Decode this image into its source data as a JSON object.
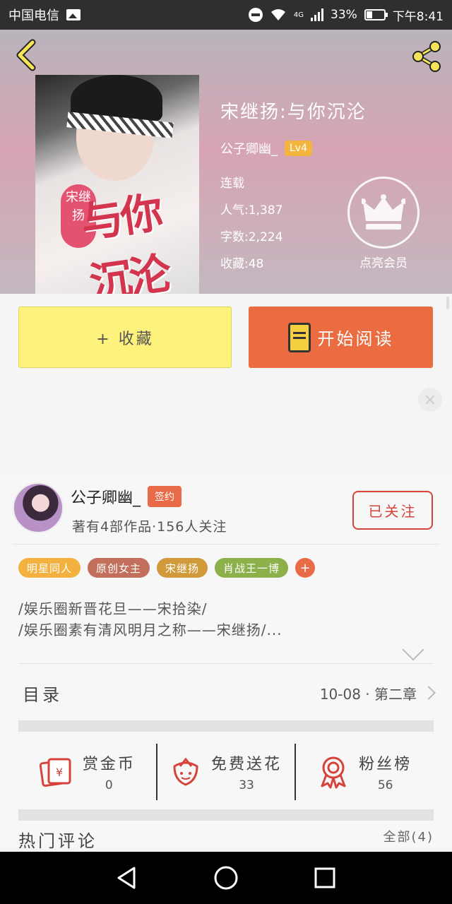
{
  "status_bar": {
    "carrier": "中国电信",
    "battery": "33%",
    "time": "下午8:41",
    "network": "4G"
  },
  "book": {
    "title": "宋继扬:与你沉沦",
    "author": "公子卿幽_",
    "level": "Lv4",
    "status": "连载",
    "popularity": "人气:1,387",
    "word_count": "字数:2,224",
    "favorites": "收藏:48",
    "cover_title": "与你沉沦",
    "cover_seal": "宋继扬"
  },
  "vip": {
    "label": "点亮会员"
  },
  "actions": {
    "favorite_label": "+ 收藏",
    "read_label": "开始阅读"
  },
  "ad": {
    "close": "×"
  },
  "author_card": {
    "name": "公子卿幽_",
    "badge": "签约",
    "summary": "著有4部作品·156人关注",
    "follow_label": "已关注"
  },
  "tags": [
    {
      "label": "明星同人",
      "color": "#f3b23f"
    },
    {
      "label": "原创女主",
      "color": "#c26f5b"
    },
    {
      "label": "宋继扬",
      "color": "#d19a3a"
    },
    {
      "label": "肖战王一博",
      "color": "#8cb04a"
    }
  ],
  "tag_add": "+",
  "description": {
    "line1": "/娱乐圈新晋花旦——宋拾染/",
    "line2": "/娱乐圈素有清风明月之称——宋继扬/..."
  },
  "toc": {
    "title": "目录",
    "latest": "10-08 · 第二章"
  },
  "stats": [
    {
      "name": "赏金币",
      "value": "0"
    },
    {
      "name": "免费送花",
      "value": "33"
    },
    {
      "name": "粉丝榜",
      "value": "56"
    }
  ],
  "hot_comments": {
    "title": "热门评论",
    "all": "全部(4)"
  },
  "colors": {
    "accent_orange": "#ea6c40",
    "favorite_yellow": "#fdf27b",
    "follow_red": "#d6433a"
  }
}
